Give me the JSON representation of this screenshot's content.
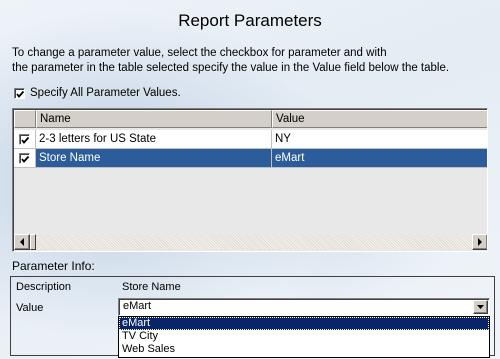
{
  "window": {
    "title": "Report Parameters"
  },
  "instructions": {
    "line1": "To change a parameter value, select the checkbox for parameter and with",
    "line2": "the parameter in the table selected specify the value in the Value field below the table."
  },
  "specify_all": {
    "label": "Specify All Parameter Values.",
    "checked": true
  },
  "grid": {
    "columns": [
      "Name",
      "Value"
    ],
    "rows": [
      {
        "checked": true,
        "name": "2-3 letters for US State",
        "value": "NY",
        "selected": false
      },
      {
        "checked": true,
        "name": "Store Name",
        "value": "eMart",
        "selected": true
      }
    ]
  },
  "parameter_info": {
    "heading": "Parameter Info:",
    "description_label": "Description",
    "description_value": "Store Name",
    "value_label": "Value",
    "value_selected": "eMart",
    "options": [
      "eMart",
      "TV City",
      "Web Sales"
    ]
  },
  "colors": {
    "selection": "#2c5d9a",
    "dropdown_highlight": "#0a246a"
  },
  "icons": [
    "checkmark-icon",
    "scroll-left-arrow-icon",
    "scroll-right-arrow-icon",
    "dropdown-arrow-icon"
  ]
}
